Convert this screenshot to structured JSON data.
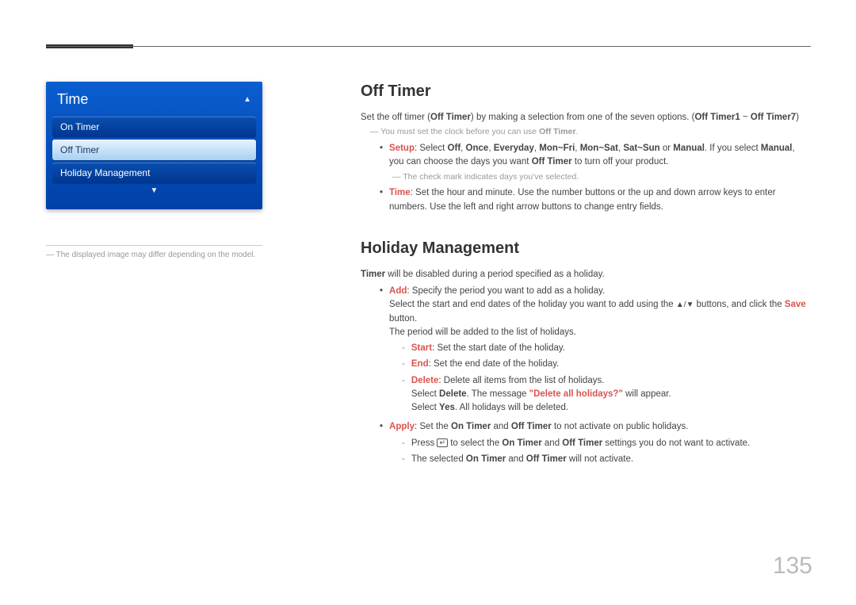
{
  "pageNumber": "135",
  "menu": {
    "title": "Time",
    "items": [
      {
        "label": "On Timer",
        "selected": false
      },
      {
        "label": "Off Timer",
        "selected": true
      },
      {
        "label": "Holiday Management",
        "selected": false
      }
    ]
  },
  "leftNote": "The displayed image may differ depending on the model.",
  "sections": {
    "offTimer": {
      "heading": "Off Timer",
      "intro_a": "Set the off timer (",
      "intro_b": "Off Timer",
      "intro_c": ") by making a selection from one of the seven options. (",
      "intro_d": "Off Timer1",
      "intro_e": " ~ ",
      "intro_f": "Off Timer7",
      "intro_g": ")",
      "note1_a": "You must set the clock before you can use ",
      "note1_b": "Off Timer",
      "note1_c": ".",
      "setup_label": "Setup",
      "setup_a": ": Select ",
      "setup_opts": [
        "Off",
        "Once",
        "Everyday",
        "Mon~Fri",
        "Mon~Sat",
        "Sat~Sun"
      ],
      "setup_or": " or ",
      "setup_manual": "Manual",
      "setup_b": ". If you select ",
      "setup_c": ", you can choose the days you want ",
      "setup_d": "Off Timer",
      "setup_e": " to turn off your product.",
      "note2": "The check mark indicates days you've selected.",
      "time_label": "Time",
      "time_text": ": Set the hour and minute. Use the number buttons or the up and down arrow keys to enter numbers. Use the left and right arrow buttons to change entry fields."
    },
    "holiday": {
      "heading": "Holiday Management",
      "intro_a": "Timer",
      "intro_b": " will be disabled during a period specified as a holiday.",
      "add_label": "Add",
      "add_a": ": Specify the period you want to add as a holiday.",
      "add_line2_a": "Select the start and end dates of the holiday you want to add using the ",
      "add_line2_b": " buttons, and click the ",
      "add_line2_save": "Save",
      "add_line2_c": " button.",
      "add_line3": "The period will be added to the list of holidays.",
      "start_label": "Start",
      "start_text": ": Set the start date of the holiday.",
      "end_label": "End",
      "end_text": ": Set the end date of the holiday.",
      "delete_label": "Delete",
      "delete_a": ": Delete all items from the list of holidays.",
      "delete_line2_a": "Select ",
      "delete_line2_b": "Delete",
      "delete_line2_c": ". The message ",
      "delete_line2_msg": "\"Delete all holidays?\"",
      "delete_line2_d": " will appear.",
      "delete_line3_a": "Select ",
      "delete_line3_b": "Yes",
      "delete_line3_c": ". All holidays will be deleted.",
      "apply_label": "Apply",
      "apply_a": ": Set the ",
      "apply_on": "On Timer",
      "apply_and": " and ",
      "apply_off": "Off Timer",
      "apply_b": " to not activate on public holidays.",
      "apply_sub1_a": "Press ",
      "apply_sub1_b": " to select the ",
      "apply_sub1_c": " settings you do not want to activate.",
      "apply_sub2_a": "The selected ",
      "apply_sub2_b": " will not activate."
    }
  }
}
